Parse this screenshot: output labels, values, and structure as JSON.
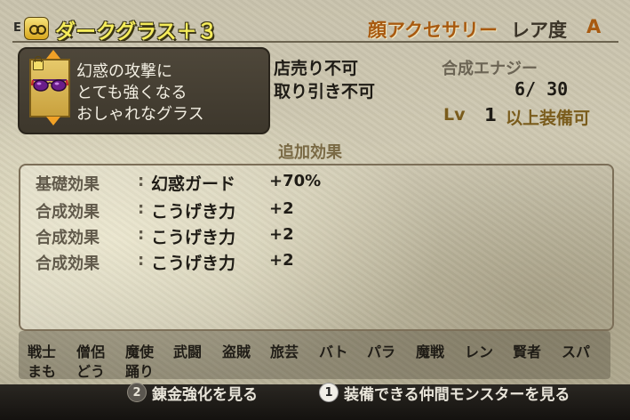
{
  "header": {
    "e_mark": "E",
    "item_name": "ダークグラス＋３",
    "slot_type": "顔アクセサリー",
    "rarity_label": "レア度",
    "rarity_value": "A"
  },
  "description": {
    "lines": [
      "幻惑の攻撃に",
      "とても強くなる",
      "おしゃれなグラス"
    ]
  },
  "info": {
    "shop": "店売り不可",
    "trade": "取り引き不可",
    "synth_label": "合成エナジー",
    "synth_value": "6/ 30",
    "lv_label": "Lv",
    "lv_value": "1",
    "lv_tail": "以上装備可"
  },
  "effects": {
    "title": "追加効果",
    "rows": [
      {
        "label": "基礎効果",
        "colon": ":",
        "name": "幻惑ガード",
        "value": "+70%",
        "color": "#615a4b"
      },
      {
        "label": "合成効果",
        "colon": ":",
        "name": "こうげき力",
        "value": "+2",
        "color": "#615a4b"
      },
      {
        "label": "合成効果",
        "colon": ":",
        "name": "こうげき力",
        "value": "+2",
        "color": "#615a4b"
      },
      {
        "label": "合成効果",
        "colon": ":",
        "name": "こうげき力",
        "value": "+2",
        "color": "#615a4b"
      }
    ]
  },
  "jobs": {
    "row1": [
      "戦士",
      "僧侶",
      "魔使",
      "武闘",
      "盗賊",
      "旅芸",
      "バト",
      "パラ",
      "魔戦",
      "レン",
      "賢者",
      "スパ"
    ],
    "row2": [
      "まも",
      "どう",
      "踊り"
    ]
  },
  "buttons": {
    "b2_num": "2",
    "b2_label": "錬金強化を見る",
    "b1_num": "1",
    "b1_label": "装備できる仲間モンスターを見る"
  },
  "colors": {
    "name": "#f5ec5a",
    "slot": "#a85a10",
    "arrow": "#f1a126"
  },
  "icons": [
    "equipped-icon",
    "lock-icon",
    "glasses-icon",
    "arrow-up-icon",
    "arrow-down-icon"
  ]
}
